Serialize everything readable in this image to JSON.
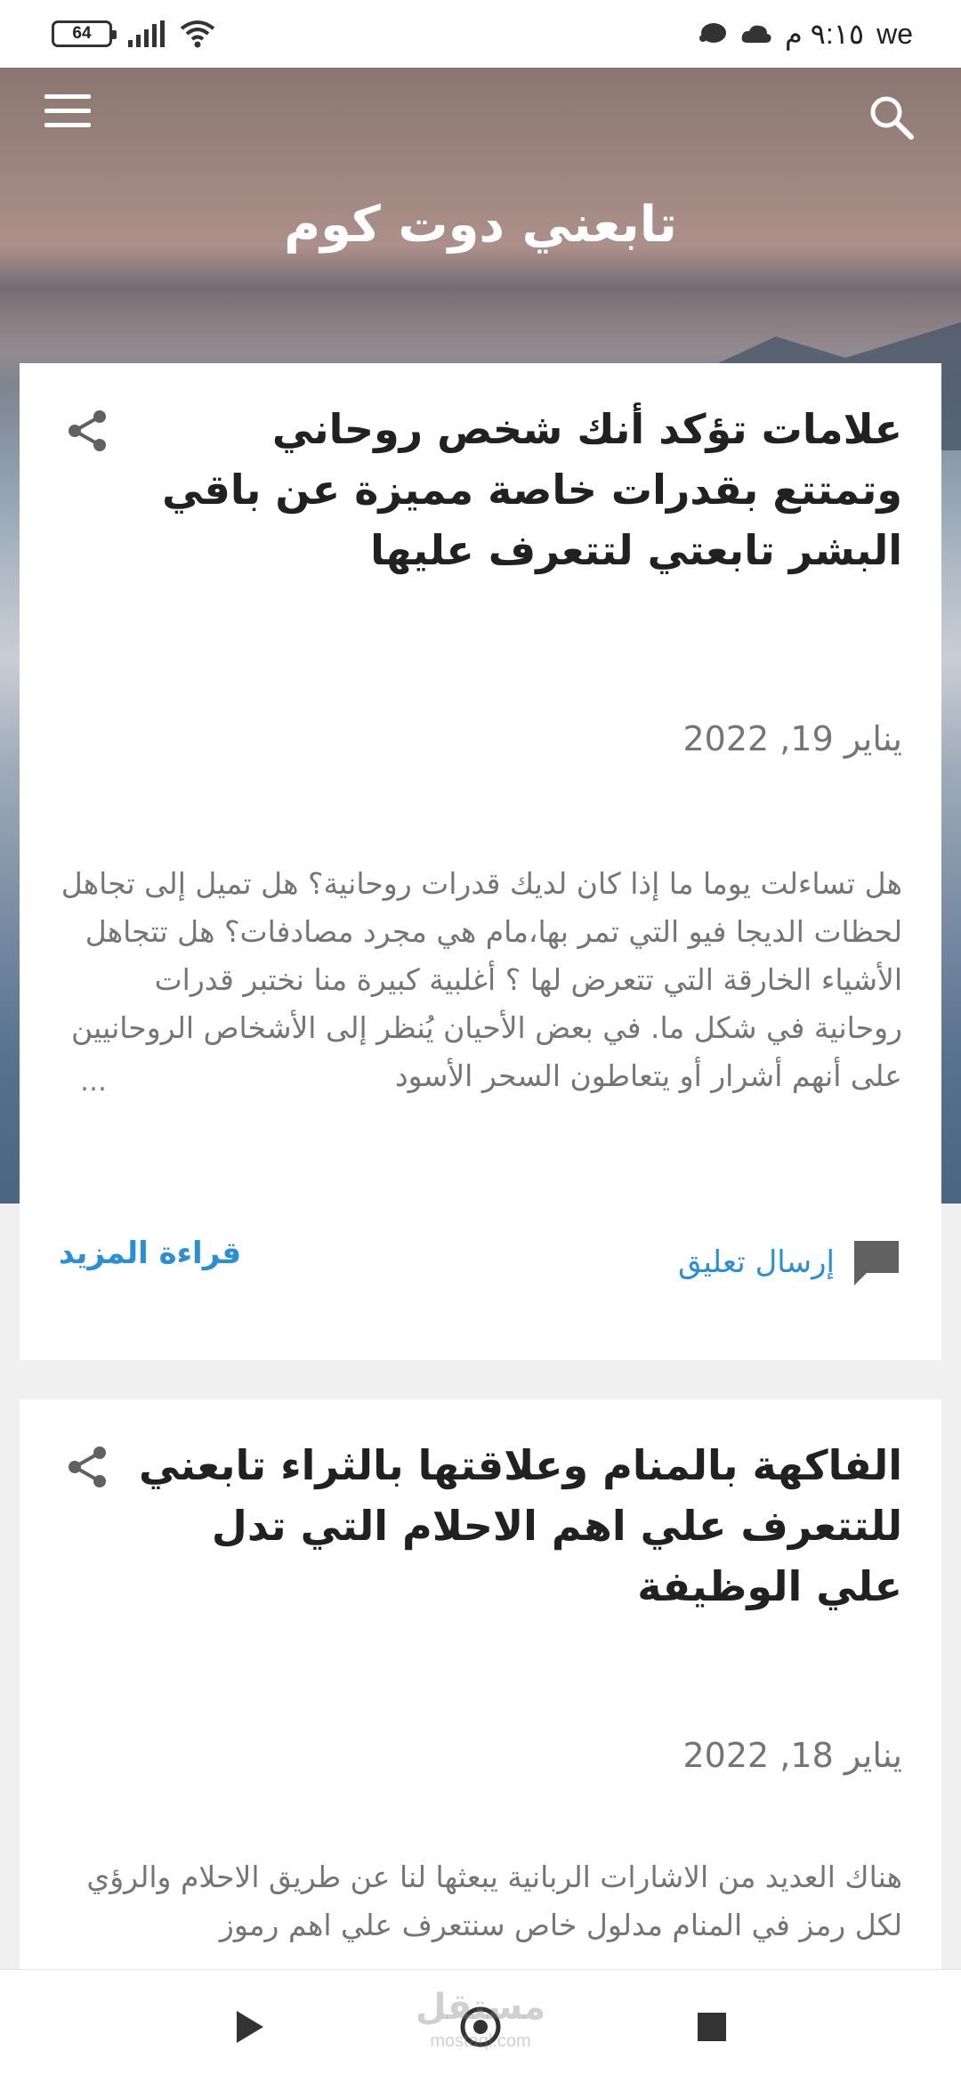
{
  "status_bar": {
    "battery": "64",
    "time": "٩:١٥ م",
    "carrier": "we"
  },
  "header": {
    "site_title": "تابعني دوت كوم"
  },
  "posts": [
    {
      "title": "علامات تؤكد أنك شخص روحاني وتمتتع بقدرات خاصة مميزة عن باقي البشر تابعتي لتتعرف عليها",
      "date": "يناير 19, 2022",
      "excerpt": "هل تساءلت يوما ما إذا كان لديك قدرات روحانية؟ هل تميل إلى تجاهل لحظات الديجا فيو التي تمر بها،مام هي مجرد مصادفات؟ هل تتجاهل الأشياء الخارقة التي تتعرض لها ؟ أغلبية كبيرة منا نختبر قدرات روحانية في شكل ما. في بعض الأحيان يُنظر إلى الأشخاص الروحانيين على أنهم أشرار أو يتعاطون السحر الأسود",
      "ellipsis": "…",
      "comment_label": "إرسال تعليق",
      "read_more_label": "قراءة المزيد"
    },
    {
      "title": "الفاكهة بالمنام وعلاقتها بالثراء تابعني للتتعرف علي اهم الاحلام التي تدل علي الوظيفة",
      "date": "يناير 18, 2022",
      "excerpt": "هناك العديد من الاشارات الربانية يبعثها لنا عن طريق الاحلام والرؤي لكل رمز في المنام مدلول خاص سنتعرف علي اهم رموز"
    }
  ],
  "watermark": {
    "text": "مستقل",
    "sub": "mostaql.com"
  },
  "icons": {
    "menu": "hamburger-icon",
    "search": "search-icon",
    "share": "share-icon",
    "comment": "comment-icon",
    "back": "play-icon",
    "home": "circle-icon",
    "recents": "square-icon"
  },
  "colors": {
    "link": "#2b8fd6",
    "title": "#212121",
    "muted": "#757575"
  }
}
